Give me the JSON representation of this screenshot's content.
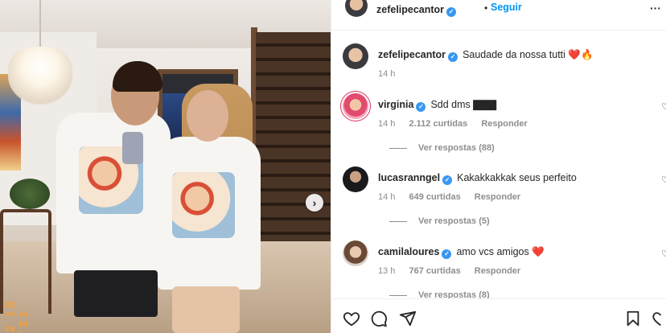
{
  "photo": {
    "date_stamp": "2 18 '21"
  },
  "post_header": {
    "username": "zefelipecantor",
    "separator": "•",
    "follow_label": "Seguir",
    "more_label": "···"
  },
  "caption": {
    "username": "zefelipecantor",
    "text": "Saudade da nossa tutti ❤️🔥",
    "time": "14 h"
  },
  "comments": [
    {
      "username": "virginia",
      "text": "Sdd dms ▇▇▇",
      "time": "14 h",
      "likes": "2.112 curtidas",
      "reply_label": "Responder",
      "view_replies": "Ver respostas (88)"
    },
    {
      "username": "lucasranngel",
      "text": "Kakakkakkak seus perfeito",
      "time": "14 h",
      "likes": "649 curtidas",
      "reply_label": "Responder",
      "view_replies": "Ver respostas (5)"
    },
    {
      "username": "camilaloures",
      "text": "amo vcs amigos ❤️",
      "time": "13 h",
      "likes": "767 curtidas",
      "reply_label": "Responder",
      "view_replies": "Ver respostas (8)"
    }
  ],
  "icons": {
    "like": "heart-icon",
    "comment": "comment-icon",
    "share": "send-icon",
    "save": "bookmark-icon",
    "next": "chevron-right-icon",
    "verified": "verified-badge-icon"
  },
  "colors": {
    "accent_blue": "#0095f6",
    "verified_blue": "#3897f0",
    "muted_text": "#8e8e8e",
    "primary_text": "#262626"
  }
}
